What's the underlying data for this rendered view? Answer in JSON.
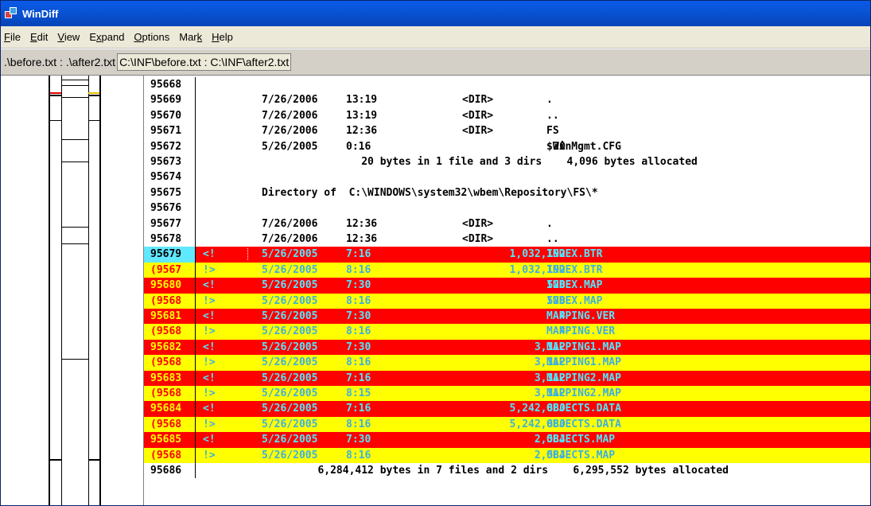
{
  "window": {
    "title": "WinDiff"
  },
  "menu": [
    {
      "pre": "",
      "u": "F",
      "post": "ile"
    },
    {
      "pre": "",
      "u": "E",
      "post": "dit"
    },
    {
      "pre": "",
      "u": "V",
      "post": "iew"
    },
    {
      "pre": "E",
      "u": "x",
      "post": "pand"
    },
    {
      "pre": "",
      "u": "O",
      "post": "ptions"
    },
    {
      "pre": "Mar",
      "u": "k",
      "post": ""
    },
    {
      "pre": "",
      "u": "H",
      "post": "elp"
    }
  ],
  "pathbar": {
    "label": ".\\before.txt : .\\after2.txt",
    "box": "C:\\INF\\before.txt : C:\\INF\\after2.txt"
  },
  "colors": {
    "left_only": "#ff0000",
    "right_only": "#ffff00",
    "cursor": "#60e8ff"
  },
  "rows": [
    {
      "ln": "95668",
      "kind": "same",
      "mk": "",
      "date": "",
      "time": "",
      "dir": "",
      "size": "",
      "name": "",
      "free": ""
    },
    {
      "ln": "95669",
      "kind": "same",
      "mk": "",
      "date": "7/26/2006",
      "time": "13:19",
      "dir": "<DIR>",
      "size": "",
      "name": ".",
      "free": ""
    },
    {
      "ln": "95670",
      "kind": "same",
      "mk": "",
      "date": "7/26/2006",
      "time": "13:19",
      "dir": "<DIR>",
      "size": "",
      "name": "..",
      "free": ""
    },
    {
      "ln": "95671",
      "kind": "same",
      "mk": "",
      "date": "7/26/2006",
      "time": "12:36",
      "dir": "<DIR>",
      "size": "",
      "name": "FS",
      "free": ""
    },
    {
      "ln": "95672",
      "kind": "same",
      "mk": "",
      "date": "5/26/2005",
      "time": "0:16",
      "dir": "",
      "size": "20",
      "name": "$WinMgmt.CFG",
      "free": ""
    },
    {
      "ln": "95673",
      "kind": "same",
      "mk": "",
      "date": "",
      "time": "",
      "dir": "",
      "size": "",
      "name": "",
      "free": "                20 bytes in 1 file and 3 dirs    4,096 bytes allocated"
    },
    {
      "ln": "95674",
      "kind": "same",
      "mk": "",
      "date": "",
      "time": "",
      "dir": "",
      "size": "",
      "name": "",
      "free": ""
    },
    {
      "ln": "95675",
      "kind": "same",
      "mk": "",
      "date": "",
      "time": "",
      "dir": "",
      "size": "",
      "name": "",
      "free": "Directory of  C:\\WINDOWS\\system32\\wbem\\Repository\\FS\\*"
    },
    {
      "ln": "95676",
      "kind": "same",
      "mk": "",
      "date": "",
      "time": "",
      "dir": "",
      "size": "",
      "name": "",
      "free": ""
    },
    {
      "ln": "95677",
      "kind": "same",
      "mk": "",
      "date": "7/26/2006",
      "time": "12:36",
      "dir": "<DIR>",
      "size": "",
      "name": ".",
      "free": ""
    },
    {
      "ln": "95678",
      "kind": "same",
      "mk": "",
      "date": "7/26/2006",
      "time": "12:36",
      "dir": "<DIR>",
      "size": "",
      "name": "..",
      "free": ""
    },
    {
      "ln": "95679",
      "kind": "left",
      "mk": "<!",
      "date": "5/26/2005",
      "time": "7:16",
      "dir": "",
      "size": "1,032,192",
      "name": "INDEX.BTR",
      "free": "",
      "cur": true
    },
    {
      "ln": "(9567",
      "kind": "right",
      "mk": "!>",
      "date": "5/26/2005",
      "time": "8:16",
      "dir": "",
      "size": "1,032,192",
      "name": "INDEX.BTR",
      "free": ""
    },
    {
      "ln": "95680",
      "kind": "left",
      "mk": "<!",
      "date": "5/26/2005",
      "time": "7:30",
      "dir": "",
      "size": "528",
      "name": "INDEX.MAP",
      "free": ""
    },
    {
      "ln": "(9568",
      "kind": "right",
      "mk": "!>",
      "date": "5/26/2005",
      "time": "8:16",
      "dir": "",
      "size": "528",
      "name": "INDEX.MAP",
      "free": ""
    },
    {
      "ln": "95681",
      "kind": "left",
      "mk": "<!",
      "date": "5/26/2005",
      "time": "7:30",
      "dir": "",
      "size": "4",
      "name": "MAPPING.VER",
      "free": ""
    },
    {
      "ln": "(9568",
      "kind": "right",
      "mk": "!>",
      "date": "5/26/2005",
      "time": "8:16",
      "dir": "",
      "size": "4",
      "name": "MAPPING.VER",
      "free": ""
    },
    {
      "ln": "95682",
      "kind": "left",
      "mk": "<!",
      "date": "5/26/2005",
      "time": "7:30",
      "dir": "",
      "size": "3,112",
      "name": "MAPPING1.MAP",
      "free": ""
    },
    {
      "ln": "(9568",
      "kind": "right",
      "mk": "!>",
      "date": "5/26/2005",
      "time": "8:16",
      "dir": "",
      "size": "3,112",
      "name": "MAPPING1.MAP",
      "free": ""
    },
    {
      "ln": "95683",
      "kind": "left",
      "mk": "<!",
      "date": "5/26/2005",
      "time": "7:16",
      "dir": "",
      "size": "3,112",
      "name": "MAPPING2.MAP",
      "free": ""
    },
    {
      "ln": "(9568",
      "kind": "right",
      "mk": "!>",
      "date": "5/26/2005",
      "time": "8:15",
      "dir": "",
      "size": "3,112",
      "name": "MAPPING2.MAP",
      "free": ""
    },
    {
      "ln": "95684",
      "kind": "left",
      "mk": "<!",
      "date": "5/26/2005",
      "time": "7:16",
      "dir": "",
      "size": "5,242,880",
      "name": "OBJECTS.DATA",
      "free": ""
    },
    {
      "ln": "(9568",
      "kind": "right",
      "mk": "!>",
      "date": "5/26/2005",
      "time": "8:16",
      "dir": "",
      "size": "5,242,880",
      "name": "OBJECTS.DATA",
      "free": ""
    },
    {
      "ln": "95685",
      "kind": "left",
      "mk": "<!",
      "date": "5/26/2005",
      "time": "7:30",
      "dir": "",
      "size": "2,584",
      "name": "OBJECTS.MAP",
      "free": ""
    },
    {
      "ln": "(9568",
      "kind": "right",
      "mk": "!>",
      "date": "5/26/2005",
      "time": "8:16",
      "dir": "",
      "size": "2,584",
      "name": "OBJECTS.MAP",
      "free": ""
    },
    {
      "ln": "95686",
      "kind": "same",
      "mk": "",
      "date": "",
      "time": "",
      "dir": "",
      "size": "",
      "name": "",
      "free": "         6,284,412 bytes in 7 files and 2 dirs    6,295,552 bytes allocated"
    }
  ]
}
